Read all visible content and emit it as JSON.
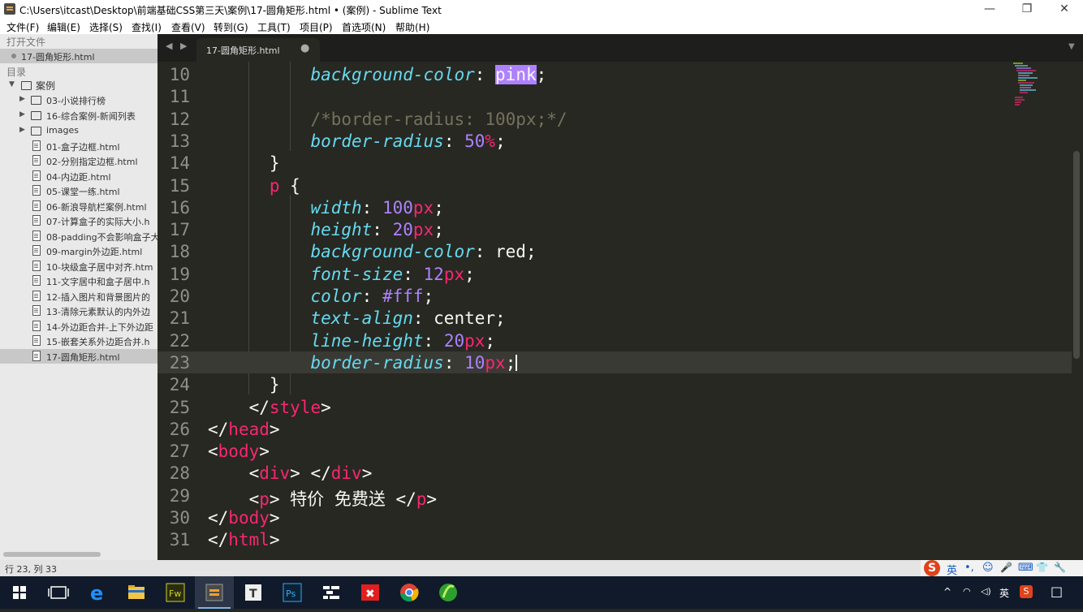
{
  "window": {
    "title": "C:\\Users\\itcast\\Desktop\\前端基础CSS第三天\\案例\\17-圆角矩形.html • (案例) - Sublime Text",
    "minimize": "—",
    "maximize": "❐",
    "close": "✕"
  },
  "menu": [
    "文件(F)",
    "编辑(E)",
    "选择(S)",
    "查找(I)",
    "查看(V)",
    "转到(G)",
    "工具(T)",
    "项目(P)",
    "首选项(N)",
    "帮助(H)"
  ],
  "sidebar": {
    "open_files_heading": "打开文件",
    "open_file": "17-圆角矩形.html",
    "folders_heading": "目录",
    "root_folder": "案例",
    "subfolders": [
      "03-小说排行榜",
      "16-综合案例-新闻列表",
      "images"
    ],
    "files": [
      "01-盒子边框.html",
      "02-分别指定边框.html",
      "04-内边距.html",
      "05-课堂一练.html",
      "06-新浪导航栏案例.html",
      "07-计算盒子的实际大小.h",
      "08-padding不会影响盒子大",
      "09-margin外边距.html",
      "10-块级盒子居中对齐.htm",
      "11-文字居中和盒子居中.h",
      "12-插入图片和背景图片的",
      "13-清除元素默认的内外边",
      "14-外边距合并-上下外边距",
      "15-嵌套关系外边距合并.h",
      "17-圆角矩形.html"
    ]
  },
  "tab": {
    "label": "17-圆角矩形.html",
    "dirty_marker": "●",
    "nav": "◀ ▶",
    "menu": "▼"
  },
  "code_lines": [
    {
      "n": "10",
      "indent": "          ",
      "seg": [
        [
          "background-color",
          "prop"
        ],
        [
          ": ",
          ""
        ],
        [
          "pink",
          "sel"
        ],
        [
          ";",
          ""
        ]
      ]
    },
    {
      "n": "11",
      "indent": "",
      "seg": []
    },
    {
      "n": "12",
      "indent": "          ",
      "seg": [
        [
          "/*border-radius: 100px;*/",
          "cmt"
        ]
      ]
    },
    {
      "n": "13",
      "indent": "          ",
      "seg": [
        [
          "border-radius",
          "prop"
        ],
        [
          ": ",
          ""
        ],
        [
          "50",
          "num"
        ],
        [
          "%",
          "unit"
        ],
        [
          ";",
          ""
        ]
      ]
    },
    {
      "n": "14",
      "indent": "      ",
      "seg": [
        [
          "}",
          ""
        ]
      ]
    },
    {
      "n": "15",
      "indent": "      ",
      "seg": [
        [
          "p",
          "tag"
        ],
        [
          " {",
          ""
        ]
      ]
    },
    {
      "n": "16",
      "indent": "          ",
      "seg": [
        [
          "width",
          "prop"
        ],
        [
          ": ",
          ""
        ],
        [
          "100",
          "num"
        ],
        [
          "px",
          "unit"
        ],
        [
          ";",
          ""
        ]
      ]
    },
    {
      "n": "17",
      "indent": "          ",
      "seg": [
        [
          "height",
          "prop"
        ],
        [
          ": ",
          ""
        ],
        [
          "20",
          "num"
        ],
        [
          "px",
          "unit"
        ],
        [
          ";",
          ""
        ]
      ]
    },
    {
      "n": "18",
      "indent": "          ",
      "seg": [
        [
          "background-color",
          "prop"
        ],
        [
          ": red;",
          ""
        ]
      ]
    },
    {
      "n": "19",
      "indent": "          ",
      "seg": [
        [
          "font-size",
          "prop"
        ],
        [
          ": ",
          ""
        ],
        [
          "12",
          "num"
        ],
        [
          "px",
          "unit"
        ],
        [
          ";",
          ""
        ]
      ]
    },
    {
      "n": "20",
      "indent": "          ",
      "seg": [
        [
          "color",
          "prop"
        ],
        [
          ": ",
          ""
        ],
        [
          "#fff",
          "num"
        ],
        [
          ";",
          ""
        ]
      ]
    },
    {
      "n": "21",
      "indent": "          ",
      "seg": [
        [
          "text-align",
          "prop"
        ],
        [
          ": center;",
          ""
        ]
      ]
    },
    {
      "n": "22",
      "indent": "          ",
      "seg": [
        [
          "line-height",
          "prop"
        ],
        [
          ": ",
          ""
        ],
        [
          "20",
          "num"
        ],
        [
          "px",
          "unit"
        ],
        [
          ";",
          ""
        ]
      ]
    },
    {
      "n": "23",
      "indent": "          ",
      "seg": [
        [
          "border-radius",
          "prop"
        ],
        [
          ": ",
          ""
        ],
        [
          "10",
          "num"
        ],
        [
          "px",
          "unit"
        ],
        [
          ";",
          ""
        ]
      ],
      "current": true
    },
    {
      "n": "24",
      "indent": "      ",
      "seg": [
        [
          "}",
          ""
        ]
      ]
    },
    {
      "n": "25",
      "indent": "    ",
      "seg": [
        [
          "</",
          ""
        ],
        [
          "style",
          "tag"
        ],
        [
          ">",
          ""
        ]
      ]
    },
    {
      "n": "26",
      "indent": "",
      "seg": [
        [
          "</",
          ""
        ],
        [
          "head",
          "tag"
        ],
        [
          ">",
          ""
        ]
      ]
    },
    {
      "n": "27",
      "indent": "",
      "seg": [
        [
          "<",
          ""
        ],
        [
          "body",
          "tag"
        ],
        [
          ">",
          ""
        ]
      ]
    },
    {
      "n": "28",
      "indent": "    ",
      "seg": [
        [
          "<",
          ""
        ],
        [
          "div",
          "tag"
        ],
        [
          "> </",
          ""
        ],
        [
          "div",
          "tag"
        ],
        [
          ">",
          ""
        ]
      ]
    },
    {
      "n": "29",
      "indent": "    ",
      "seg": [
        [
          "<",
          ""
        ],
        [
          "p",
          "tag"
        ],
        [
          "> 特价 免费送 </",
          ""
        ],
        [
          "p",
          "tag"
        ],
        [
          ">",
          ""
        ]
      ]
    },
    {
      "n": "30",
      "indent": "",
      "seg": [
        [
          "</",
          ""
        ],
        [
          "body",
          "tag"
        ],
        [
          ">",
          ""
        ]
      ]
    },
    {
      "n": "31",
      "indent": "",
      "seg": [
        [
          "</",
          ""
        ],
        [
          "html",
          "tag"
        ],
        [
          ">",
          ""
        ]
      ]
    }
  ],
  "status": {
    "position": "行 23, 列 33"
  },
  "ime": {
    "logo": "S",
    "mode": "英",
    "punct": "•,",
    "icons": [
      "☺",
      "🎤",
      "⌨",
      "👕",
      "🔧"
    ]
  },
  "tray": {
    "chevron": "^",
    "lang": "英",
    "notify": "□"
  },
  "taskbar_apps": [
    "start",
    "task-view",
    "edge",
    "file-explorer",
    "fireworks",
    "sublime-text",
    "typora",
    "photoshop",
    "code-tool",
    "xmind",
    "chrome",
    "browser-green"
  ],
  "colors": {
    "editor_bg": "#272822",
    "keyword_pink": "#f92672",
    "property_blue": "#66d9ef",
    "number_purple": "#ae81ff",
    "comment": "#75715e"
  }
}
